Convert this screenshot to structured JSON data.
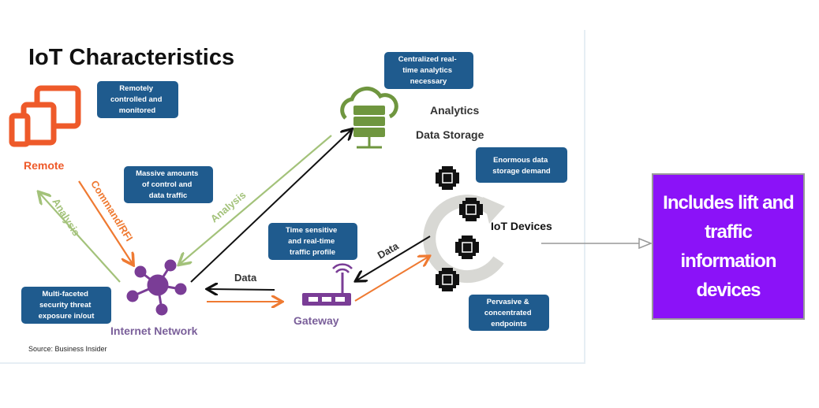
{
  "diagram": {
    "title": "IoT Characteristics",
    "source": "Source: Business Insider",
    "nodes": {
      "remote": "Remote",
      "internet_network": "Internet Network",
      "gateway": "Gateway",
      "analytics": "Analytics",
      "data_storage": "Data Storage",
      "iot_devices": "IoT Devices"
    },
    "info_boxes": {
      "remote_control": [
        "Remotely",
        "controlled and",
        "monitored"
      ],
      "traffic": [
        "Massive amounts",
        "of control and",
        "data traffic"
      ],
      "analytics": [
        "Centralized real-",
        "time analytics",
        "necessary"
      ],
      "storage": [
        "Enormous data",
        "storage demand"
      ],
      "time_sensitive": [
        "Time sensitive",
        "and real-time",
        "traffic profile"
      ],
      "security": [
        "Multi-faceted",
        "security threat",
        "exposure in/out"
      ],
      "endpoints": [
        "Pervasive &",
        "concentrated",
        "endpoints"
      ]
    },
    "arrow_labels": {
      "analysis_left": "Analysis",
      "command": "Command/RFI",
      "analysis_center": "Analysis",
      "data_gateway": "Data",
      "data_devices": "Data"
    },
    "colors": {
      "box": "#1f5b8e",
      "remote": "#ee5a2a",
      "network": "#7a3d96",
      "storage": "#6f963f",
      "analysis_arrow": "#a3c27a",
      "command_arrow": "#ef7a32",
      "callout": "#8b12f8"
    }
  },
  "callout": {
    "text": "Includes lift and traffic information devices"
  }
}
